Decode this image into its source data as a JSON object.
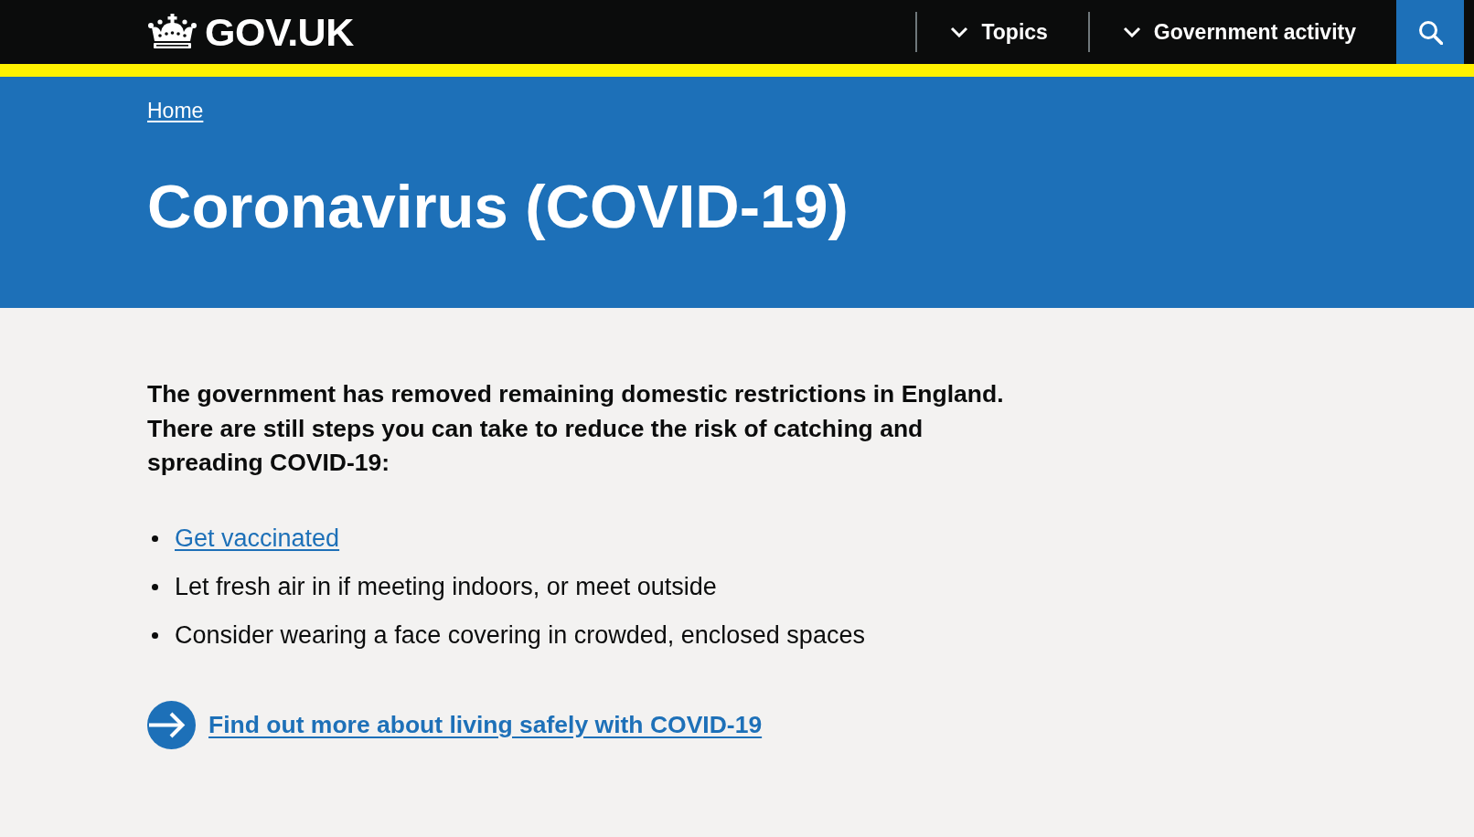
{
  "header": {
    "logo": "GOV.UK",
    "nav": [
      {
        "label": "Topics",
        "expanded": false
      },
      {
        "label": "Government activity",
        "expanded": false
      }
    ]
  },
  "breadcrumbs": [
    {
      "label": "Home"
    }
  ],
  "title": "Coronavirus (COVID-19)",
  "intro": "The government has removed remaining domestic restrictions in England. There are still steps you can take to reduce the risk of catching and spreading COVID-19:",
  "steps": [
    {
      "kind": "link",
      "text": "Get vaccinated"
    },
    {
      "kind": "text",
      "text": "Let fresh air in if meeting indoors, or meet outside"
    },
    {
      "kind": "text",
      "text": "Consider wearing a face covering in crowded, enclosed spaces"
    }
  ],
  "call_to_action": {
    "text": "Find out more about living safely with COVID-19"
  }
}
